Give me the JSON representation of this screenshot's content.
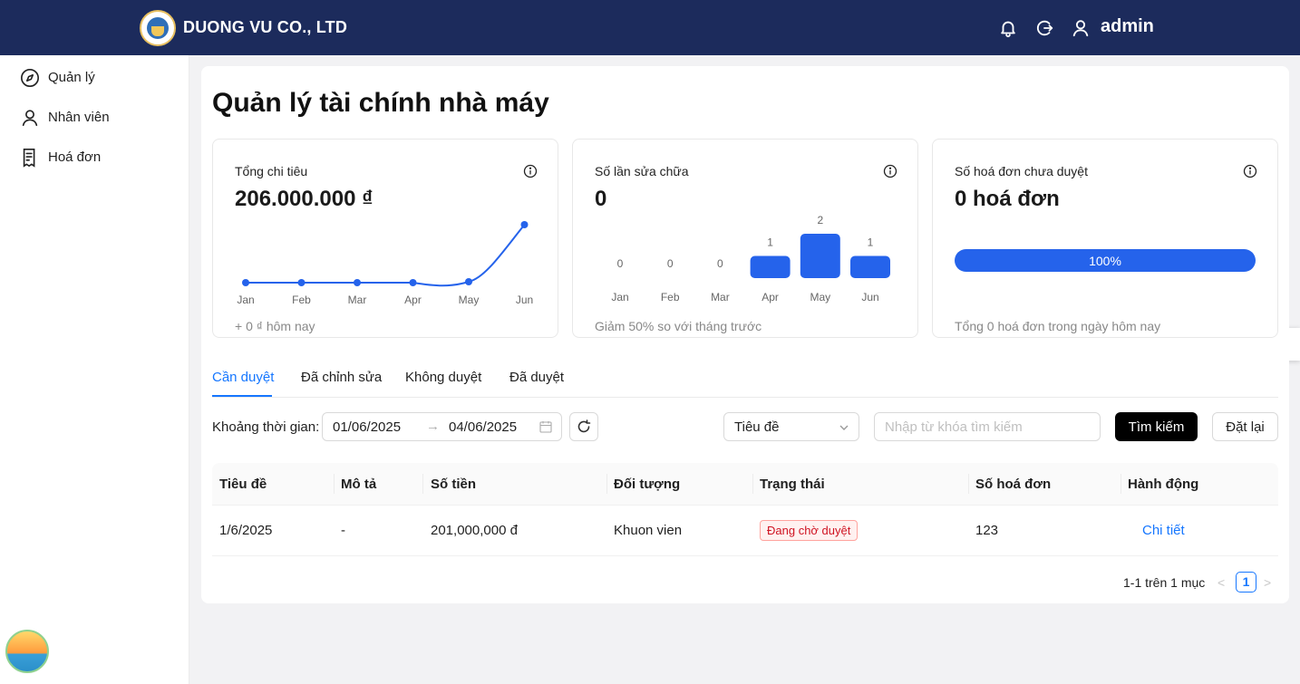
{
  "header": {
    "brand": "DUONG VU CO., LTD",
    "user": "admin",
    "icons": [
      "bell-icon",
      "logout-icon",
      "user-icon"
    ]
  },
  "sidebar": {
    "items": [
      {
        "label": "Quản lý",
        "icon": "compass-icon"
      },
      {
        "label": "Nhân viên",
        "icon": "user-icon"
      },
      {
        "label": "Hoá đơn",
        "icon": "invoice-icon"
      }
    ]
  },
  "main": {
    "title": "Quản lý tài chính nhà máy",
    "stats": [
      {
        "label": "Tổng chi tiêu",
        "value": "206.000.000 ₫",
        "foot": "+ 0 ₫ hôm nay"
      },
      {
        "label": "Số lần sửa chữa",
        "value": "0",
        "foot": "Giảm 50% so với tháng trước"
      },
      {
        "label": "Số hoá đơn chưa duyệt",
        "value": "0 hoá đơn",
        "foot": "Tổng 0 hoá đơn trong ngày hôm nay",
        "progress_label": "100%",
        "progress": 1.0
      }
    ],
    "tabs": [
      "Cần duyệt",
      "Đã chỉnh sửa",
      "Không duyệt",
      "Đã duyệt"
    ],
    "active_tab": 0,
    "filters": {
      "range_label": "Khoảng thời gian:",
      "start_date": "01/06/2025",
      "end_date": "04/06/2025",
      "field_select": "Tiêu đề",
      "search_placeholder": "Nhập từ khóa tìm kiếm",
      "search_button": "Tìm kiếm",
      "reset_button": "Đặt lại"
    },
    "table": {
      "columns": [
        "Tiêu đề",
        "Mô tả",
        "Số tiền",
        "Đối tượng",
        "Trạng thái",
        "Số hoá đơn",
        "Hành động"
      ],
      "rows": [
        {
          "title": "1/6/2025",
          "desc": "-",
          "amount": "201,000,000 đ",
          "target": "Khuon vien",
          "status": "Đang chờ duyệt",
          "invoice": "123",
          "action": "Chi tiết"
        }
      ]
    },
    "pagination": {
      "summary": "1-1 trên 1 mục",
      "prev": "<",
      "page": "1",
      "next": ">"
    }
  },
  "colors": {
    "header_bg": "#1c2b5c",
    "accent": "#1677ff",
    "chart": "#2563eb",
    "status_pending": "#cf1322"
  },
  "chart_data": [
    {
      "type": "line",
      "categories": [
        "Jan",
        "Feb",
        "Mar",
        "Apr",
        "May",
        "Jun"
      ],
      "values": [
        0.1,
        0.1,
        0.1,
        0.1,
        0.05,
        1.0
      ],
      "note": "relative shape only"
    },
    {
      "type": "bar",
      "categories": [
        "Jan",
        "Feb",
        "Mar",
        "Apr",
        "May",
        "Jun"
      ],
      "values": [
        0,
        0,
        0,
        1,
        2,
        1
      ]
    }
  ]
}
